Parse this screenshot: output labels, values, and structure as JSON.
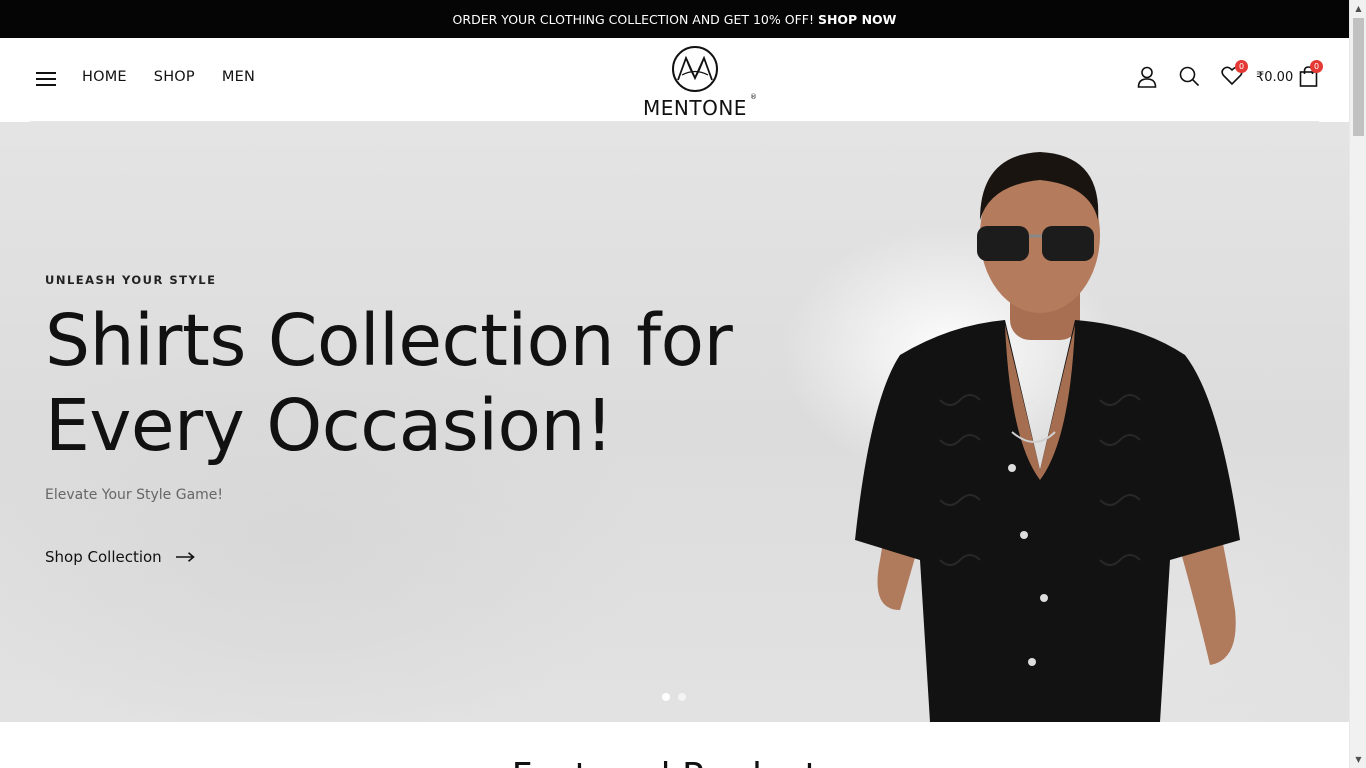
{
  "announcement": {
    "text": "ORDER YOUR CLOTHING COLLECTION AND GET 10% OFF!",
    "cta": "SHOP NOW"
  },
  "nav": {
    "menu_icon": "hamburger-menu-icon",
    "items": [
      {
        "label": "HOME"
      },
      {
        "label": "SHOP"
      },
      {
        "label": "MEN"
      }
    ]
  },
  "brand": {
    "name": "MENTONE",
    "registered": "®"
  },
  "header_icons": {
    "account_icon": "user-icon",
    "search_icon": "search-icon",
    "wishlist_icon": "heart-icon",
    "wishlist_count": "0",
    "cart_total": "₹0.00",
    "cart_icon": "shopping-bag-icon",
    "cart_count": "0"
  },
  "hero": {
    "eyebrow": "UNLEASH YOUR STYLE",
    "headline_line1": "Shirts Collection for",
    "headline_line2": "Every Occasion!",
    "subtitle": "Elevate Your Style Game!",
    "cta": "Shop Collection",
    "slides_total": 2,
    "active_slide": 1
  },
  "featured": {
    "heading": "Featured Products"
  },
  "colors": {
    "announcement_bg": "#050505",
    "badge": "#e53935",
    "text": "#111111"
  }
}
